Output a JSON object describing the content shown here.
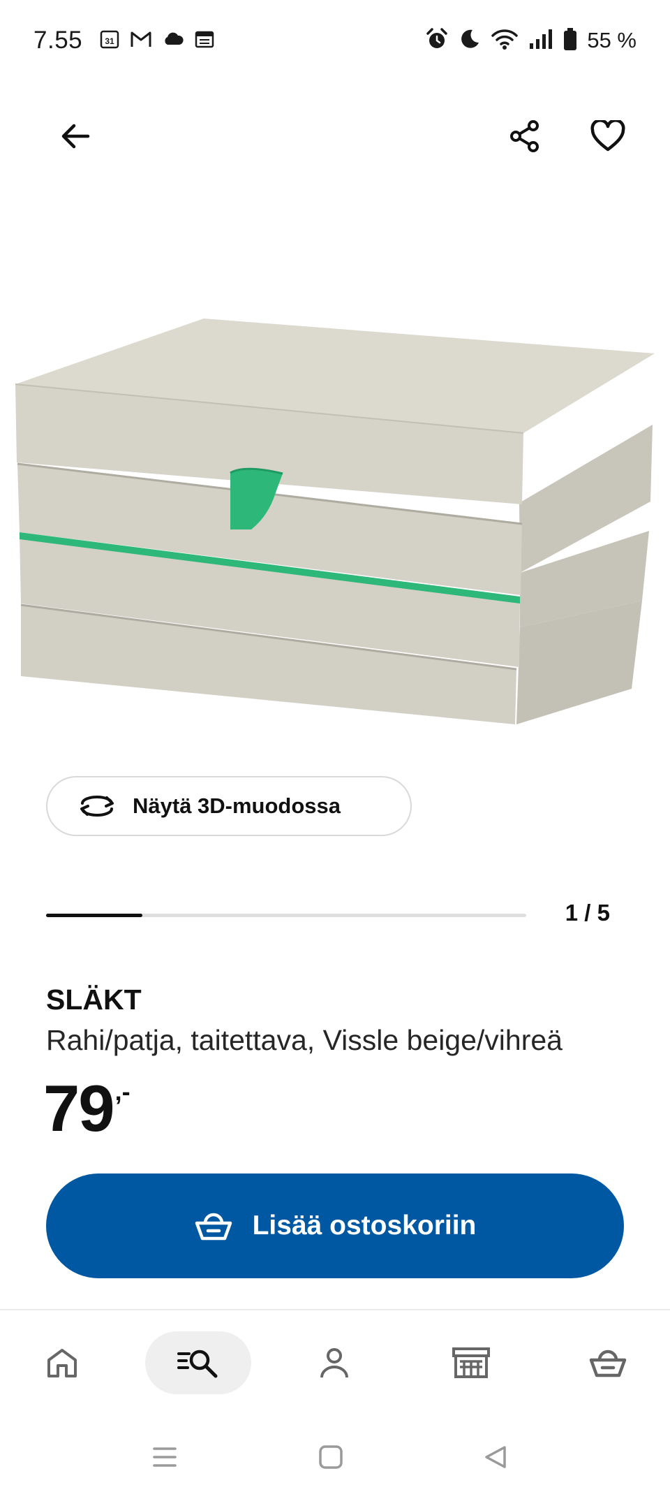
{
  "status_bar": {
    "time": "7.55",
    "calendar_day": "31",
    "battery": "55 %"
  },
  "product": {
    "view3d_label": "Näytä 3D-muodossa",
    "image_counter": "1 / 5",
    "image_progress": 0.2,
    "name": "SLÄKT",
    "description": "Rahi/patja, taitettava, Vissle beige/vihreä",
    "price_main": "79",
    "price_suffix": ",-"
  },
  "actions": {
    "add_to_cart_label": "Lisää ostoskoriin"
  },
  "colors": {
    "brand_blue": "#0058a3",
    "mattress_beige": "#d3d0c6",
    "strap_green": "#2db87a"
  },
  "icons": {
    "back": "arrow-left-icon",
    "share": "share-icon",
    "favourite": "heart-icon",
    "view3d": "rotate-icon",
    "cart": "basket-icon",
    "home": "home-icon",
    "search": "search-icon",
    "profile": "person-icon",
    "stores": "store-icon",
    "nav_cart": "basket-icon"
  }
}
